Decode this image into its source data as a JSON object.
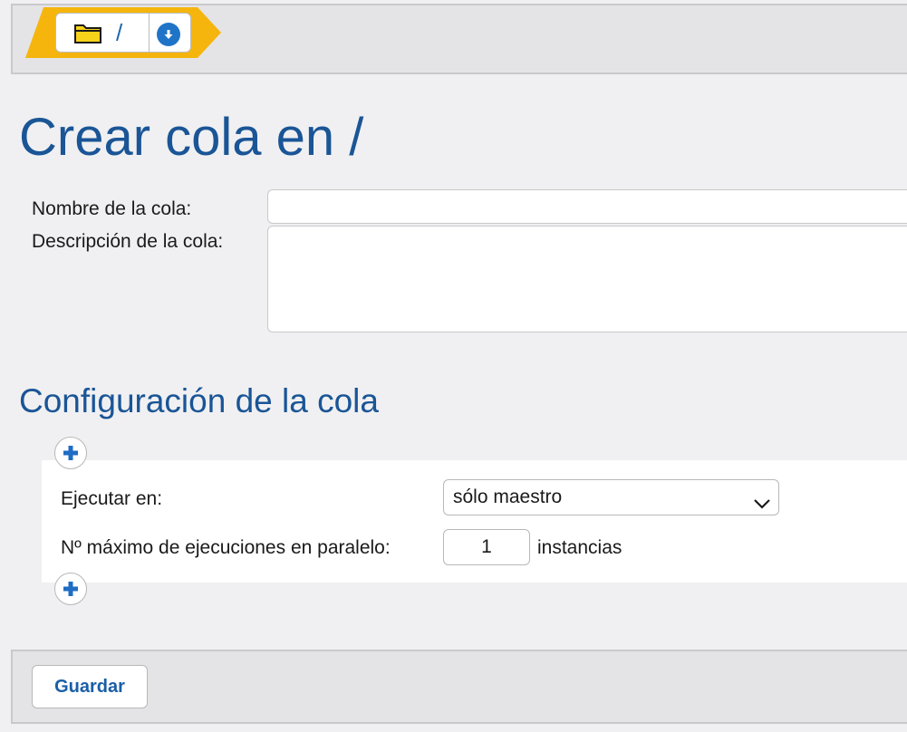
{
  "breadcrumb": {
    "path": "/"
  },
  "page": {
    "title": "Crear cola en /"
  },
  "form": {
    "name_label": "Nombre de la cola:",
    "name_value": "",
    "description_label": "Descripción de la cola:",
    "description_value": ""
  },
  "config": {
    "title": "Configuración de la cola",
    "run_on_label": "Ejecutar en:",
    "run_on_value": "sólo maestro",
    "max_parallel_label": "Nº máximo de ejecuciones en paralelo:",
    "max_parallel_value": "1",
    "max_parallel_unit": "instancias"
  },
  "footer": {
    "save_label": "Guardar"
  },
  "colors": {
    "accent": "#1a5596",
    "breadcrumb": "#f5b50d",
    "icon_blue": "#2074c7"
  },
  "icons": [
    "folder-icon",
    "download-icon",
    "plus-icon",
    "chevron-down-icon"
  ]
}
